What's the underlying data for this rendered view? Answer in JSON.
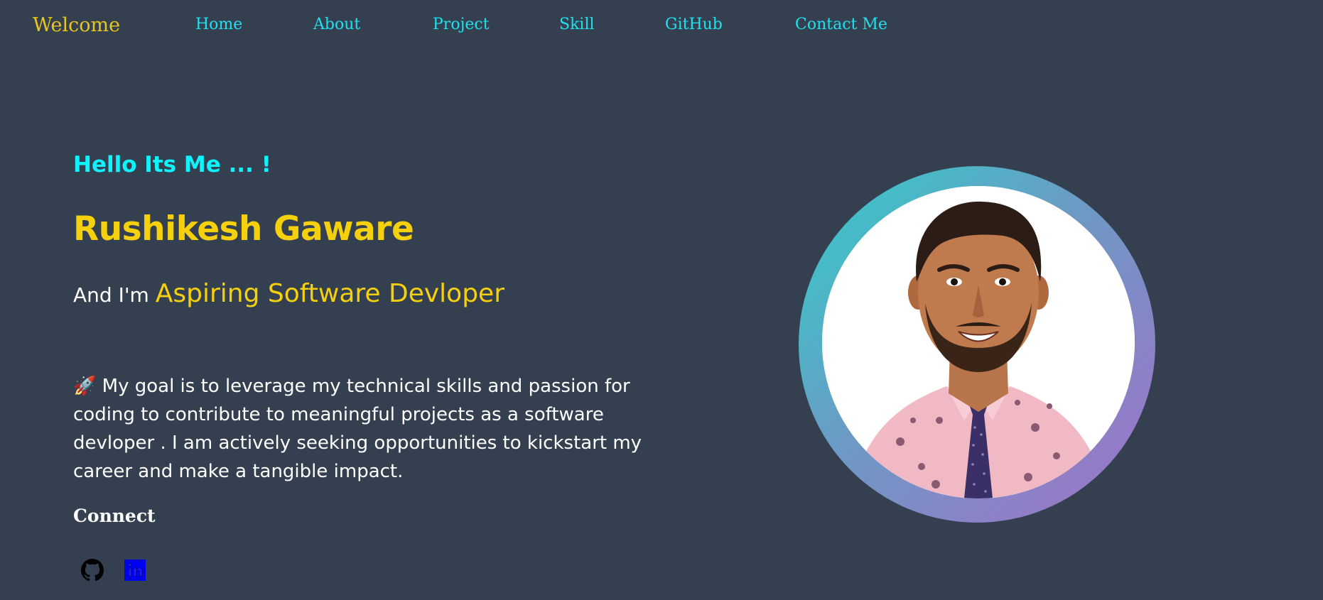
{
  "nav": {
    "brand": "Welcome",
    "links": [
      "Home",
      "About",
      "Project",
      "Skill",
      "GitHub",
      "Contact Me"
    ]
  },
  "hero": {
    "greeting": "Hello Its Me ... !",
    "name": "Rushikesh Gaware",
    "role_prefix": "And I'm ",
    "role_title": "Aspiring Software Devloper",
    "goal": "🚀 My goal is to leverage my technical skills and passion for coding to contribute to meaningful projects as a software devloper . I am actively seeking opportunities to kickstart my career and make a tangible impact.",
    "connect_label": "Connect"
  },
  "social": {
    "github_icon": "github-icon",
    "linkedin_icon": "linkedin-icon"
  },
  "colors": {
    "background": "#344050",
    "accent_yellow": "#f5d00c",
    "accent_cyan": "#0ff3ff",
    "nav_link": "#1fe0ee",
    "ring_start": "#2fcfc9",
    "ring_end": "#a36fc9"
  }
}
